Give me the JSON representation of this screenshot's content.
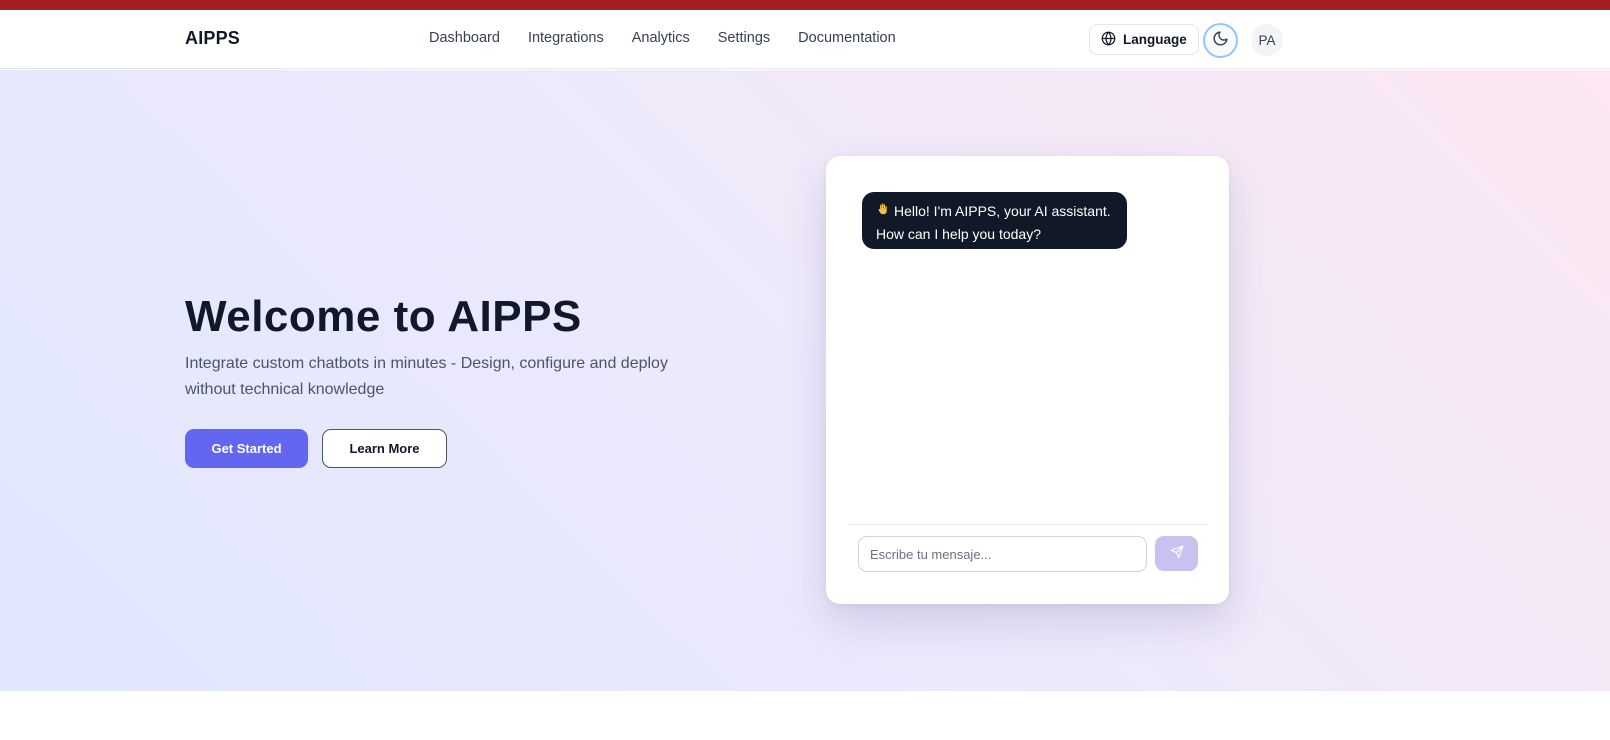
{
  "header": {
    "brand": "AIPPS",
    "nav": [
      "Dashboard",
      "Integrations",
      "Analytics",
      "Settings",
      "Documentation"
    ],
    "language_label": "Language",
    "avatar_initials": "PA"
  },
  "hero": {
    "title": "Welcome to AIPPS",
    "subtitle": "Integrate custom chatbots in minutes - Design, configure and deploy without technical knowledge",
    "primary_cta": "Get Started",
    "secondary_cta": "Learn More"
  },
  "chat": {
    "bot_message": "Hello! I'm AIPPS, your AI assistant. How can I help you today?",
    "input_placeholder": "Escribe tu mensaje..."
  },
  "colors": {
    "top_strip": "#a41e22",
    "accent": "#6366f1",
    "bubble_bg": "#111827",
    "send_button": "#c7c2f0"
  },
  "icons": {
    "language": "globe-icon",
    "theme": "moon-icon",
    "greeting": "waving-hand-icon",
    "send": "send-icon"
  }
}
